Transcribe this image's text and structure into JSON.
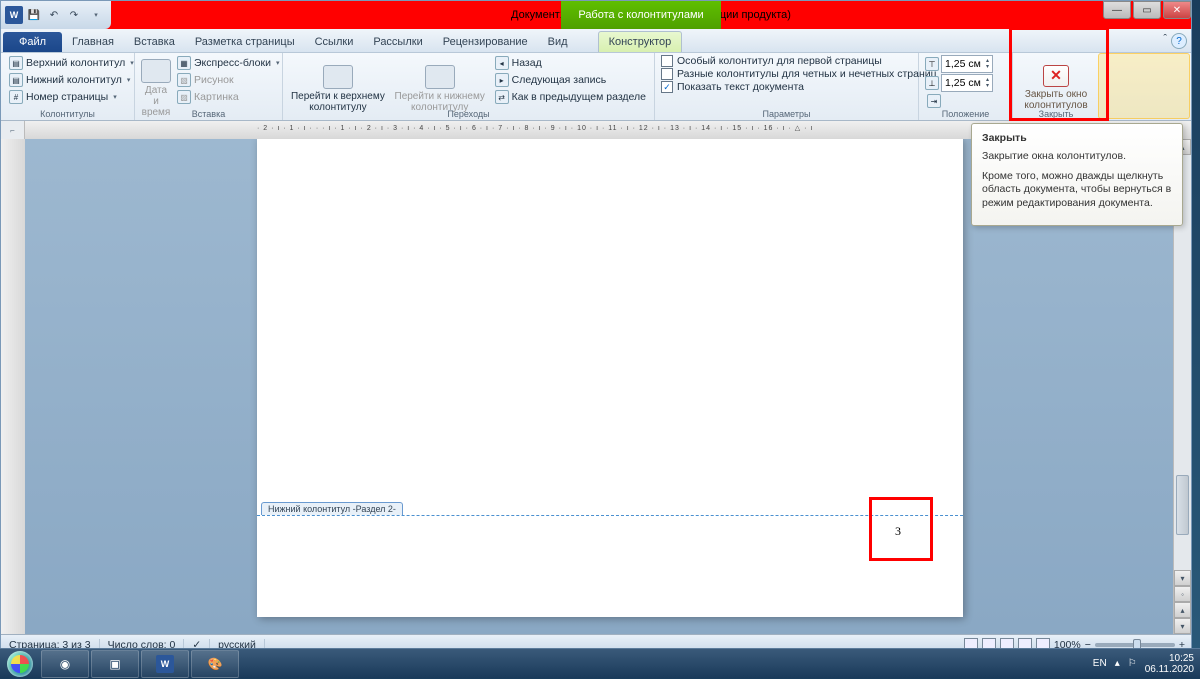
{
  "titlebar": {
    "document_title": "Документ1 - Microsoft Word (Сбой активации продукта)",
    "contextual_title": "Работа с колонтитулами"
  },
  "tabs": {
    "file": "Файл",
    "items": [
      "Главная",
      "Вставка",
      "Разметка страницы",
      "Ссылки",
      "Рассылки",
      "Рецензирование",
      "Вид"
    ],
    "contextual": "Конструктор"
  },
  "ribbon": {
    "group_hf": {
      "label": "Колонтитулы",
      "top_header": "Верхний колонтитул",
      "bottom_header": "Нижний колонтитул",
      "page_number": "Номер страницы"
    },
    "group_insert": {
      "label": "Вставка",
      "datetime": "Дата и время",
      "express": "Экспресс-блоки",
      "picture": "Рисунок",
      "clipart": "Картинка"
    },
    "group_nav": {
      "label": "Переходы",
      "goto_top": "Перейти к верхнему колонтитулу",
      "goto_bottom": "Перейти к нижнему колонтитулу",
      "back": "Назад",
      "next": "Следующая запись",
      "same_as": "Как в предыдущем разделе"
    },
    "group_options": {
      "label": "Параметры",
      "first_page": "Особый колонтитул для первой страницы",
      "odd_even": "Разные колонтитулы для четных и нечетных страниц",
      "show_doc": "Показать текст документа"
    },
    "group_position": {
      "label": "Положение",
      "val1": "1,25 см",
      "val2": "1,25 см"
    },
    "group_close": {
      "label": "Закрыть",
      "button": "Закрыть окно колонтитулов"
    }
  },
  "tooltip": {
    "title": "Закрыть",
    "line1": "Закрытие окна колонтитулов.",
    "line2": "Кроме того, можно дважды щелкнуть область документа, чтобы вернуться в режим редактирования документа."
  },
  "document": {
    "footer_tab": "Нижний колонтитул -Раздел 2-",
    "page_number_value": "3"
  },
  "ruler_text": "· 2 · ı · 1 · ı · · · ı · 1 · ı · 2 · ı · 3 · ı · 4 · ı · 5 · ı · 6 · ı · 7 · ı · 8 · ı · 9 · ı · 10 · ı · 11 · ı · 12 · ı · 13 · ı · 14 · ı · 15 · ı · 16 · ı · △ · ı",
  "statusbar": {
    "page": "Страница: 3 из 3",
    "words": "Число слов: 0",
    "lang": "русский",
    "zoom": "100%"
  },
  "tray": {
    "lang": "EN",
    "time": "10:25",
    "date": "06.11.2020"
  }
}
